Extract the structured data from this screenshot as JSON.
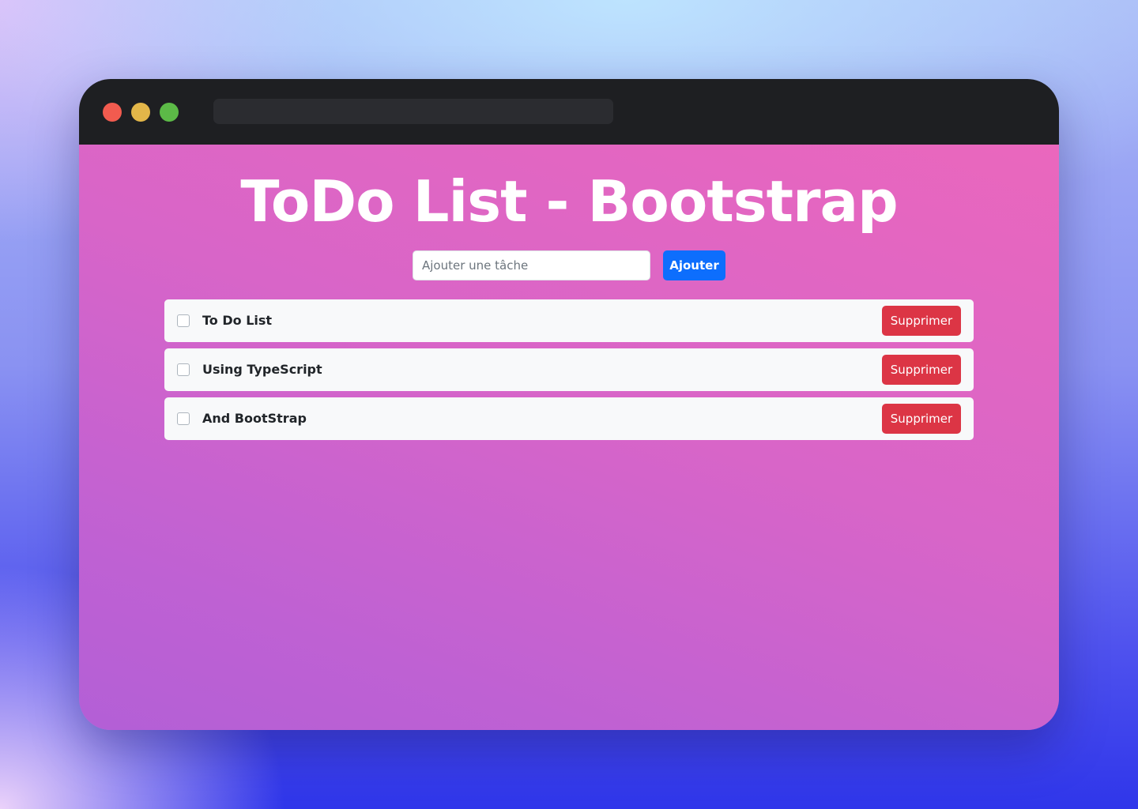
{
  "page": {
    "title": "ToDo List - Bootstrap"
  },
  "form": {
    "placeholder": "Ajouter une tâche",
    "value": "",
    "add_label": "Ajouter"
  },
  "tasks": [
    {
      "label": "To Do List",
      "checked": false,
      "delete_label": "Supprimer"
    },
    {
      "label": "Using TypeScript",
      "checked": false,
      "delete_label": "Supprimer"
    },
    {
      "label": "And BootStrap",
      "checked": false,
      "delete_label": "Supprimer"
    }
  ],
  "colors": {
    "titlebar": "#1e1f22",
    "primary": "#0d6efd",
    "danger": "#dc3545",
    "item_bg": "#f8f9fa",
    "content_gradient_start": "#ea67bd",
    "content_gradient_end": "#b35fd6"
  }
}
